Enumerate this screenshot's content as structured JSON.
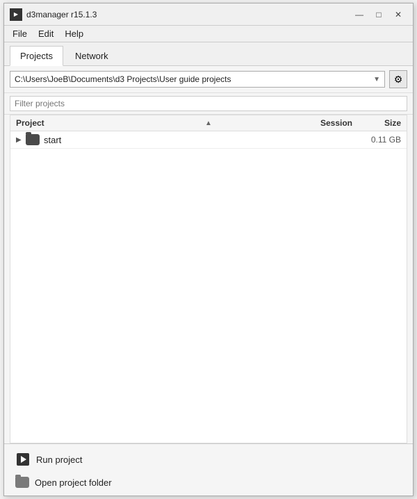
{
  "window": {
    "title": "d3manager  r15.1.3",
    "controls": {
      "minimize": "—",
      "maximize": "□",
      "close": "✕"
    }
  },
  "menu": {
    "items": [
      "File",
      "Edit",
      "Help"
    ]
  },
  "tabs": [
    {
      "label": "Projects",
      "active": true
    },
    {
      "label": "Network",
      "active": false
    }
  ],
  "toolbar": {
    "path": "C:\\Users\\JoeB\\Documents\\d3 Projects\\User guide projects",
    "settings_icon": "gear"
  },
  "filter": {
    "placeholder": "Filter projects"
  },
  "table": {
    "columns": {
      "project": "Project",
      "session": "Session",
      "size": "Size"
    },
    "rows": [
      {
        "name": "start",
        "session": "",
        "size": "0.11 GB",
        "expanded": false
      }
    ]
  },
  "footer": {
    "run_label": "Run project",
    "open_folder_label": "Open project folder"
  }
}
